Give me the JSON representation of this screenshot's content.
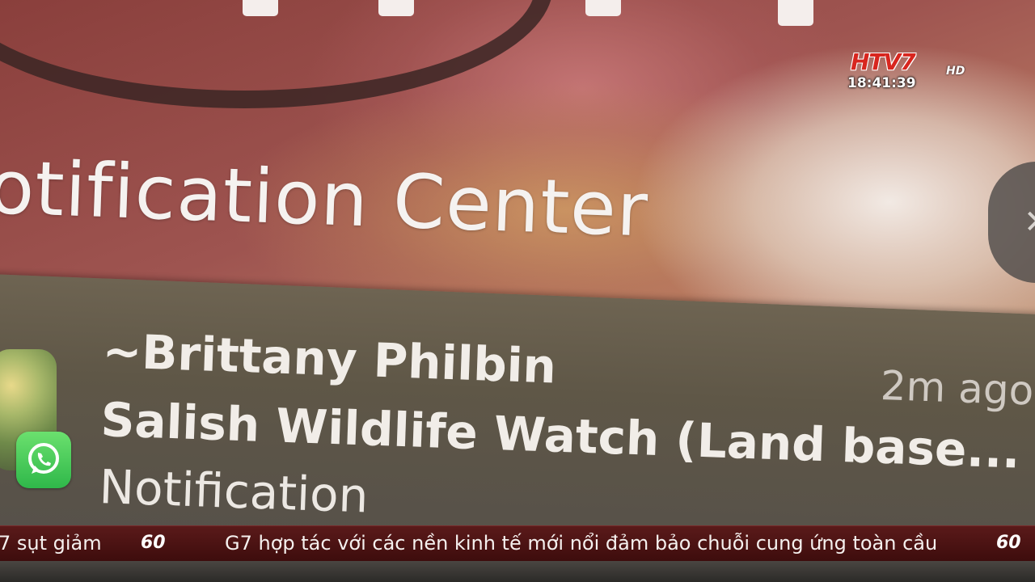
{
  "broadcast": {
    "channel_logo": "HTV7",
    "channel_logo_hd": "HD",
    "clock": "18:41:39"
  },
  "notification_center": {
    "title": "otification Center",
    "close_icon": "close-icon",
    "notification": {
      "app_icon": "group-avatar-icon",
      "badge_icon": "whatsapp-icon",
      "sender": "~Brittany Philbin",
      "time": "2m ago",
      "group": "Salish Wildlife Watch (Land base...",
      "body": "Notification"
    }
  },
  "ticker": {
    "left_fragment": "7 sụt giảm",
    "separator_label": "60",
    "headline": "G7 hợp tác với các nền kinh tế mới nổi đảm bảo chuỗi cung ứng toàn cầu",
    "right_separator_label": "60"
  },
  "colors": {
    "whatsapp_green": "#2fb84a",
    "panel_bg": "#5f5747",
    "ticker_bg": "#3d0c0c",
    "logo_red": "#d8261f"
  }
}
